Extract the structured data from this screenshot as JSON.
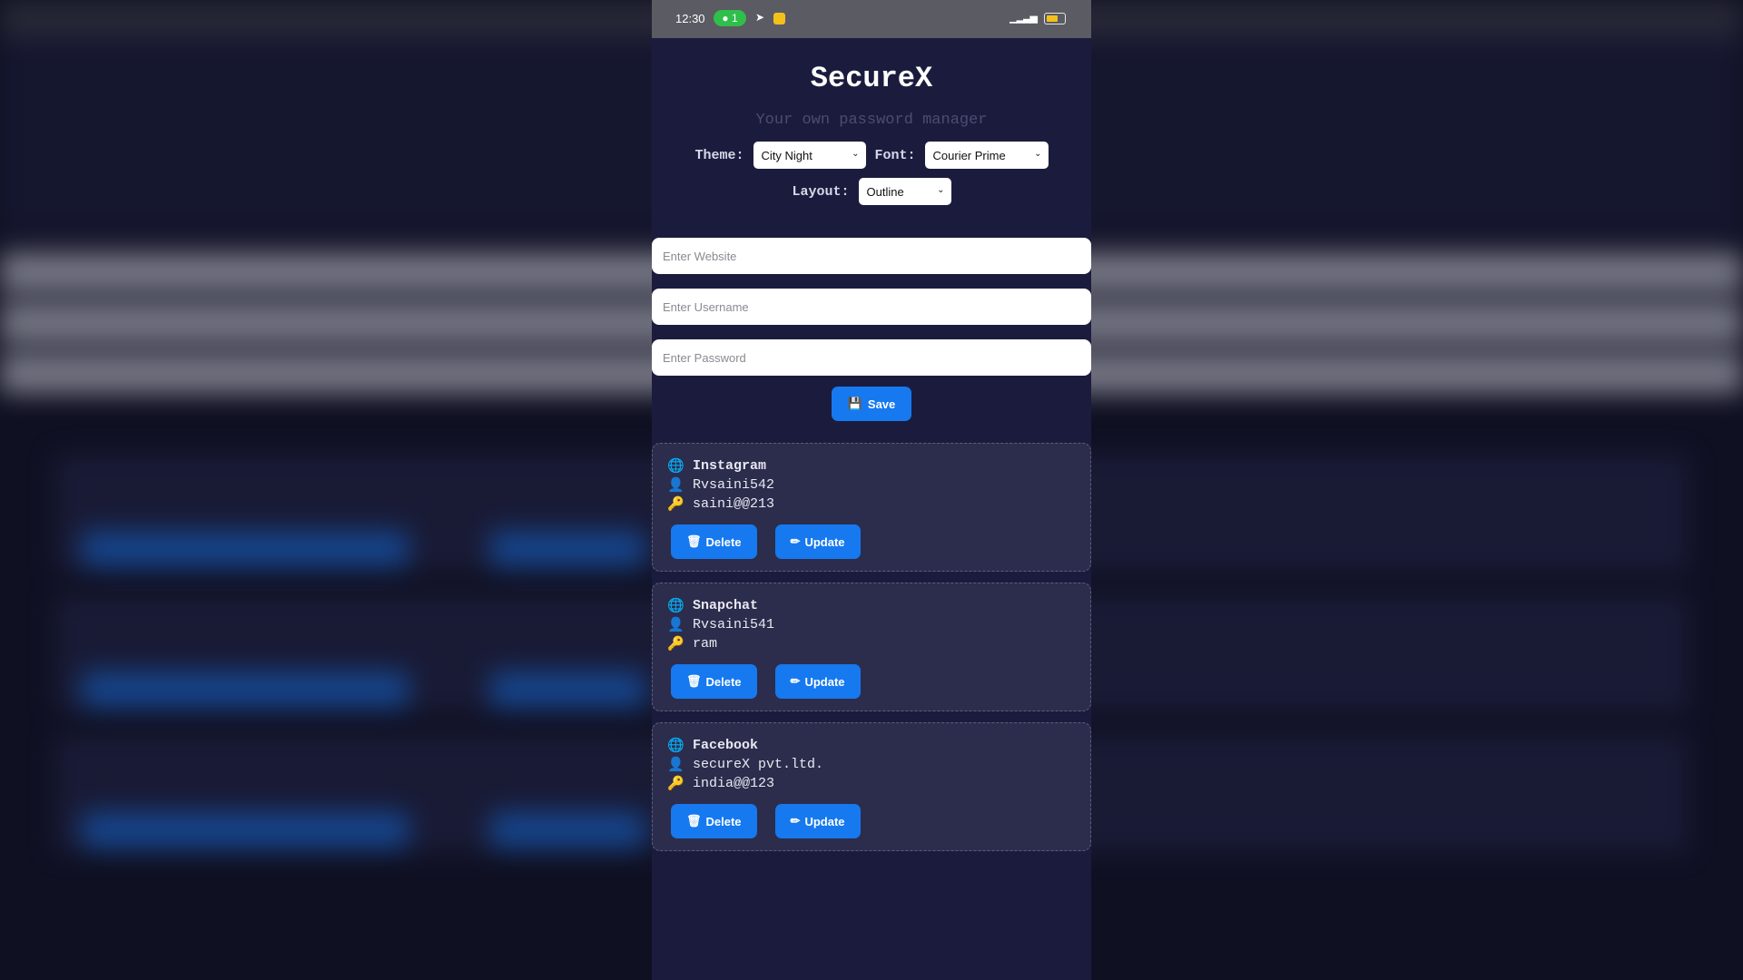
{
  "status_bar": {
    "time": "12:30",
    "badge": "1"
  },
  "app": {
    "title": "SecureX",
    "subtitle": "Your own password manager"
  },
  "controls": {
    "theme_label": "Theme:",
    "theme_value": "City Night",
    "font_label": "Font:",
    "font_value": "Courier Prime",
    "layout_label": "Layout:",
    "layout_value": "Outline"
  },
  "form": {
    "website_placeholder": "Enter Website",
    "username_placeholder": "Enter Username",
    "password_placeholder": "Enter Password",
    "save_label": "Save"
  },
  "entries": [
    {
      "site": "Instagram",
      "username": "Rvsaini542",
      "password": "saini@@213",
      "delete_label": "Delete",
      "update_label": "Update"
    },
    {
      "site": "Snapchat",
      "username": "Rvsaini541",
      "password": "ram",
      "delete_label": "Delete",
      "update_label": "Update"
    },
    {
      "site": "Facebook",
      "username": "secureX pvt.ltd.",
      "password": "india@@123",
      "delete_label": "Delete",
      "update_label": "Update"
    }
  ],
  "icons": {
    "site": "globe-icon",
    "user": "user-icon",
    "password": "key-icon",
    "delete": "trash-icon",
    "update": "pencil-icon",
    "save": "floppy-disk-icon"
  },
  "colors": {
    "background": "#1b1c3d",
    "card": "#2c2d4c",
    "accent": "#1679ef"
  }
}
